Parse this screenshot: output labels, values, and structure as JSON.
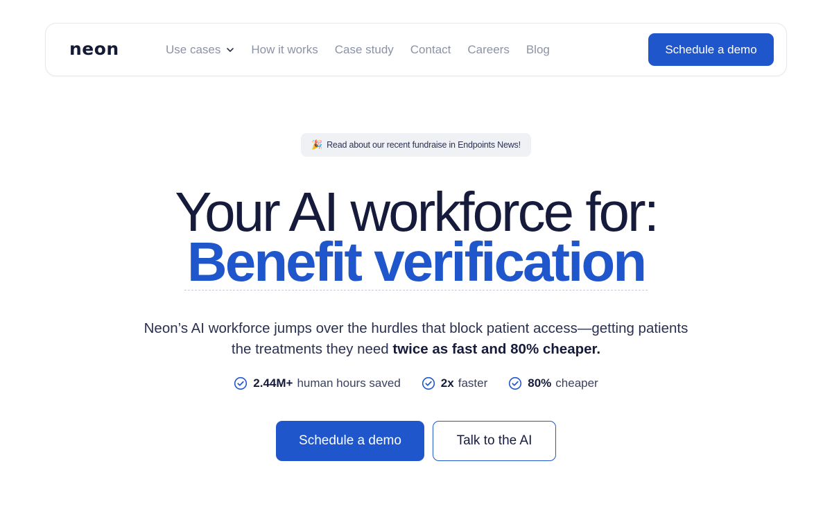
{
  "brand": {
    "logo_text": "neon",
    "accent": "#1f56cc",
    "text_dark": "#161b3c"
  },
  "nav": {
    "items": [
      {
        "label": "Use cases",
        "has_dropdown": true
      },
      {
        "label": "How it works"
      },
      {
        "label": "Case study"
      },
      {
        "label": "Contact"
      },
      {
        "label": "Careers"
      },
      {
        "label": "Blog"
      }
    ],
    "cta_label": "Schedule a demo"
  },
  "announcement": {
    "emoji": "🎉",
    "text": "Read about our recent fundraise in Endpoints News!"
  },
  "hero": {
    "headline_line1": "Your AI workforce for:",
    "headline_line2": "Benefit verification",
    "sub_text_prefix": "Neon’s AI workforce jumps over the hurdles that block patient access—getting patients the treatments they need ",
    "sub_text_bold": "twice as fast and 80% cheaper."
  },
  "stats": [
    {
      "value": "2.44M+",
      "label": "human hours saved",
      "icon": "check-circle-icon"
    },
    {
      "value": "2x",
      "label": "faster",
      "icon": "check-circle-icon"
    },
    {
      "value": "80%",
      "label": "cheaper",
      "icon": "check-circle-icon"
    }
  ],
  "ctas": {
    "primary_label": "Schedule a demo",
    "secondary_label": "Talk to the AI"
  }
}
